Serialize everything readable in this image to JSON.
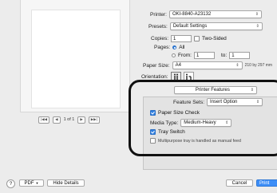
{
  "preview": {
    "page_label": "1 of 1",
    "first": "|◀◀",
    "prev": "◀",
    "next": "▶",
    "last": "▶▶|"
  },
  "printer": {
    "label": "Printer:",
    "value": "OKI-8840-A23132"
  },
  "presets": {
    "label": "Presets:",
    "value": "Default Settings"
  },
  "copies": {
    "label": "Copies:",
    "value": "1",
    "two_sided": "Two-Sided"
  },
  "pages": {
    "label": "Pages:",
    "all": "All",
    "from": "From:",
    "from_value": "1",
    "to": "to:",
    "to_value": "1"
  },
  "paper_size": {
    "label": "Paper Size:",
    "value": "A4",
    "dims": "210 by 297 mm"
  },
  "orientation": {
    "label": "Orientation:"
  },
  "panel": {
    "value": "Printer Features"
  },
  "feature_sets": {
    "label": "Feature Sets:",
    "value": "Insert Option"
  },
  "paper_size_check": "Paper Size Check",
  "media_type": {
    "label": "Media Type:",
    "value": "Medium-Heavy"
  },
  "tray_switch": "Tray Switch",
  "multipurpose": "Multipurpose tray is handled as manual feed",
  "bottom": {
    "help": "?",
    "pdf": "PDF",
    "hide_details": "Hide Details",
    "cancel": "Cancel",
    "print": "Print"
  }
}
